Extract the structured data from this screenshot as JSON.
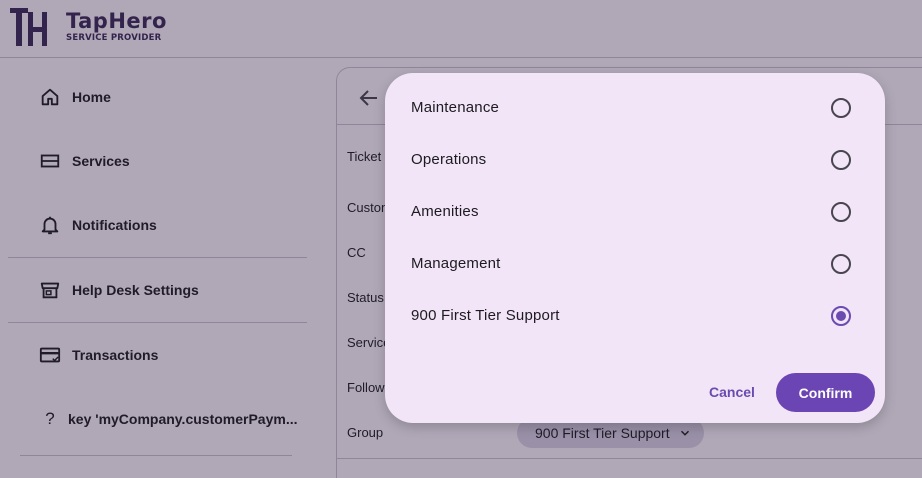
{
  "brand": {
    "name": "TapHero",
    "subtitle": "SERVICE PROVIDER",
    "logo_text": "TH"
  },
  "sidebar": {
    "items": [
      {
        "label": "Home",
        "icon": "home-icon"
      },
      {
        "label": "Services",
        "icon": "services-icon"
      },
      {
        "label": "Notifications",
        "icon": "bell-icon"
      },
      {
        "label": "Help Desk Settings",
        "icon": "storefront-icon"
      },
      {
        "label": "Transactions",
        "icon": "card-icon"
      },
      {
        "label": "key 'myCompany.customerPaym...",
        "icon": "question-icon"
      }
    ]
  },
  "form": {
    "labels": [
      "Ticket",
      "Custon",
      "CC",
      "Status",
      "Service",
      "Follow",
      "Group"
    ],
    "group_value": "900 First Tier Support"
  },
  "dialog": {
    "options": [
      {
        "label": "Maintenance",
        "selected": false
      },
      {
        "label": "Operations",
        "selected": false
      },
      {
        "label": "Amenities",
        "selected": false
      },
      {
        "label": "Management",
        "selected": false
      },
      {
        "label": "900 First Tier Support",
        "selected": true
      }
    ],
    "cancel_label": "Cancel",
    "confirm_label": "Confirm"
  },
  "colors": {
    "accent": "#6b45b3",
    "scrim": "#281c37",
    "dialog_bg": "#f1e5f7"
  }
}
